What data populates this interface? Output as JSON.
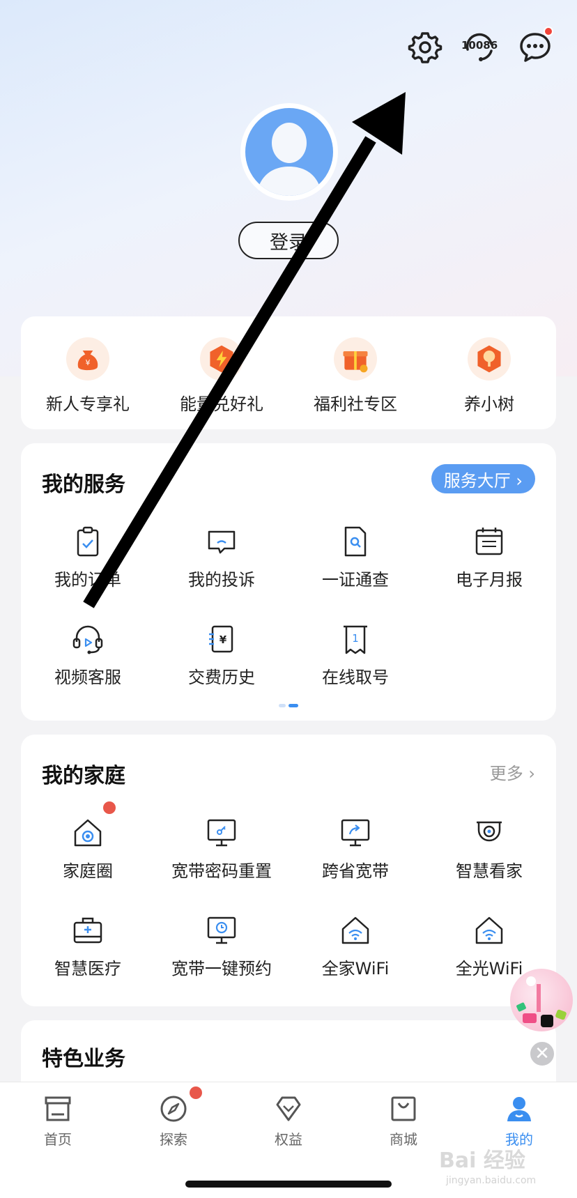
{
  "header": {
    "icons": [
      "gear-icon",
      "hotline-icon",
      "message-icon"
    ],
    "hotline_number": "10086",
    "login_label": "登录"
  },
  "gifts": [
    {
      "label": "新人专享礼",
      "icon": "gift-bag-icon"
    },
    {
      "label": "能量兑好礼",
      "icon": "energy-icon"
    },
    {
      "label": "福利社专区",
      "icon": "gift-box-icon"
    },
    {
      "label": "养小树",
      "icon": "tree-icon"
    }
  ],
  "services": {
    "title": "我的服务",
    "hall_button": "服务大厅 ›",
    "items": [
      {
        "label": "我的订单",
        "icon": "clipboard-icon"
      },
      {
        "label": "我的投诉",
        "icon": "complaint-icon"
      },
      {
        "label": "一证通查",
        "icon": "document-search-icon"
      },
      {
        "label": "电子月报",
        "icon": "calendar-icon"
      },
      {
        "label": "视频客服",
        "icon": "headset-icon"
      },
      {
        "label": "交费历史",
        "icon": "bill-icon"
      },
      {
        "label": "在线取号",
        "icon": "ticket-icon",
        "ticket_number": "1"
      }
    ]
  },
  "family": {
    "title": "我的家庭",
    "more_label": "更多 ›",
    "items": [
      {
        "label": "家庭圈",
        "icon": "home-circle-icon"
      },
      {
        "label": "宽带密码重置",
        "icon": "monitor-key-icon"
      },
      {
        "label": "跨省宽带",
        "icon": "monitor-share-icon"
      },
      {
        "label": "智慧看家",
        "icon": "camera-icon"
      },
      {
        "label": "智慧医疗",
        "icon": "medical-case-icon"
      },
      {
        "label": "宽带一键预约",
        "icon": "monitor-clock-icon"
      },
      {
        "label": "全家WiFi",
        "icon": "home-wifi-icon"
      },
      {
        "label": "全光WiFi",
        "icon": "home-wifi-light-icon"
      }
    ]
  },
  "featured": {
    "title": "特色业务"
  },
  "tabbar": [
    {
      "label": "首页",
      "icon": "store-icon",
      "active": false
    },
    {
      "label": "探索",
      "icon": "compass-icon",
      "active": false
    },
    {
      "label": "权益",
      "icon": "diamond-icon",
      "active": false
    },
    {
      "label": "商城",
      "icon": "bag-icon",
      "active": false
    },
    {
      "label": "我的",
      "icon": "person-icon",
      "active": true
    }
  ],
  "watermark": {
    "text": "Bai 经验",
    "sub": "jingyan.baidu.com"
  },
  "colors": {
    "accent": "#5a9cf2",
    "badge": "#f0443a",
    "active_tab": "#3a8ef0",
    "gift_orange": "#f0612a"
  }
}
